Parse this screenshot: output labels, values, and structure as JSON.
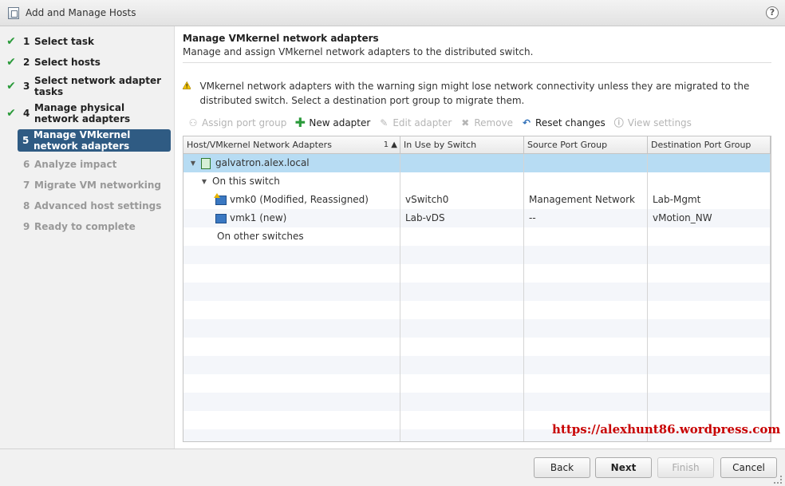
{
  "window": {
    "title": "Add and Manage Hosts",
    "help": "?"
  },
  "steps": [
    {
      "num": "1",
      "label": "Select task",
      "state": "done"
    },
    {
      "num": "2",
      "label": "Select hosts",
      "state": "done"
    },
    {
      "num": "3",
      "label": "Select network adapter tasks",
      "state": "done"
    },
    {
      "num": "4",
      "label": "Manage physical network adapters",
      "state": "done"
    },
    {
      "num": "5",
      "label": "Manage VMkernel network adapters",
      "state": "active"
    },
    {
      "num": "6",
      "label": "Analyze impact",
      "state": "pending"
    },
    {
      "num": "7",
      "label": "Migrate VM networking",
      "state": "pending"
    },
    {
      "num": "8",
      "label": "Advanced host settings",
      "state": "pending"
    },
    {
      "num": "9",
      "label": "Ready to complete",
      "state": "pending"
    }
  ],
  "page": {
    "title": "Manage VMkernel network adapters",
    "subtitle": "Manage and assign VMkernel network adapters to the distributed switch.",
    "warning": "VMkernel network adapters with the warning sign might lose network connectivity unless they are migrated to the distributed switch. Select a destination port group to migrate them."
  },
  "toolbar": {
    "assign": "Assign port group",
    "new_adapter": "New adapter",
    "edit": "Edit adapter",
    "remove": "Remove",
    "reset": "Reset changes",
    "view": "View settings"
  },
  "grid": {
    "columns": [
      "Host/VMkernel Network Adapters",
      "In Use by Switch",
      "Source Port Group",
      "Destination Port Group"
    ],
    "sort_indicator": "1 ▲",
    "host": "galvatron.alex.local",
    "group_this": "On this switch",
    "group_other": "On other switches",
    "adapters": [
      {
        "name": "vmk0 (Modified, Reassigned)",
        "switch": "vSwitch0",
        "source": "Management Network",
        "dest": "Lab-Mgmt"
      },
      {
        "name": "vmk1 (new)",
        "switch": "Lab-vDS",
        "source": "--",
        "dest": "vMotion_NW"
      }
    ]
  },
  "footer": {
    "back": "Back",
    "next": "Next",
    "finish": "Finish",
    "cancel": "Cancel"
  },
  "watermark": "https://alexhunt86.wordpress.com",
  "colors": {
    "active_step": "#2f5b83",
    "selected_row": "#b7dcf3",
    "check": "#2a9a3a",
    "watermark": "#c80000"
  }
}
